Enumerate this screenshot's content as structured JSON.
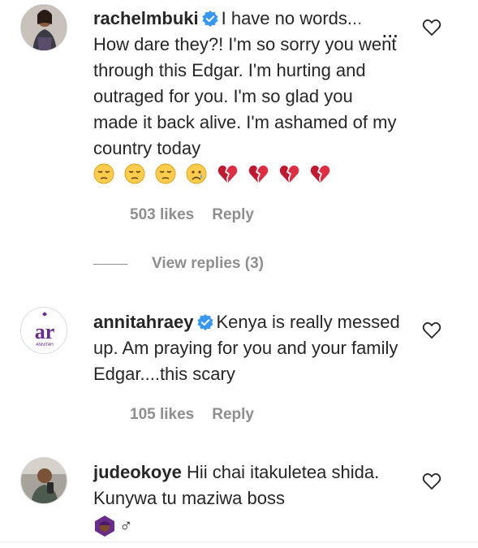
{
  "comments": [
    {
      "username": "rachelmbuki",
      "text": "I have no words... How dare they?! I'm so sorry you went through this Edgar. I'm hurting and outraged for you. I'm so glad you made it back alive. I'm ashamed of my country today",
      "emojis": [
        "pensive-face",
        "pensive-face",
        "pensive-face",
        "crying-face",
        "broken-heart",
        "broken-heart",
        "broken-heart",
        "broken-heart"
      ],
      "likes": "503 likes",
      "reply": "Reply",
      "view_replies": "View replies (3)",
      "more": "..."
    },
    {
      "username": "annitahraey",
      "avatar_text": "ANNITAH",
      "avatar_letters": "ar",
      "text": "Kenya is really messed up. Am praying for you and your family Edgar....this scary",
      "likes": "105 likes",
      "reply": "Reply"
    },
    {
      "username": "judeokoye",
      "text": "Hii chai itakuletea shida. Kunywa tu maziwa boss",
      "emoji_trail": "♂"
    }
  ],
  "colors": {
    "verified": "#3897f0",
    "meta": "#8e8e8e",
    "text": "#262626",
    "heart_stroke": "#262626"
  }
}
